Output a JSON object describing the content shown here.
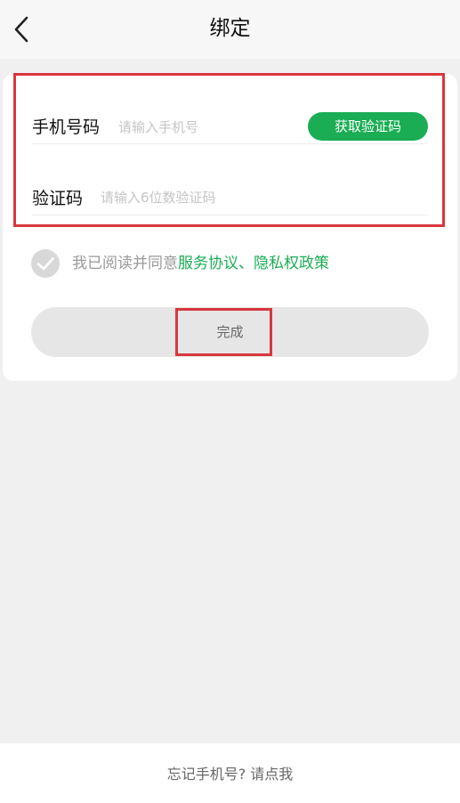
{
  "header": {
    "title": "绑定"
  },
  "form": {
    "phone_label": "手机号码",
    "phone_placeholder": "请输入手机号",
    "phone_value": "",
    "get_code_label": "获取验证码",
    "code_label": "验证码",
    "code_placeholder": "请输入6位数验证码",
    "code_value": ""
  },
  "agreement": {
    "checked": false,
    "prefix": "我已阅读并同意",
    "service_link": "服务协议",
    "separator": "、",
    "privacy_link": "隐私权政策"
  },
  "actions": {
    "done_label": "完成"
  },
  "footer": {
    "forgot_label": "忘记手机号? 请点我"
  },
  "colors": {
    "accent": "#1aad54",
    "highlight": "#d9363e",
    "background": "#f0f0f0"
  }
}
